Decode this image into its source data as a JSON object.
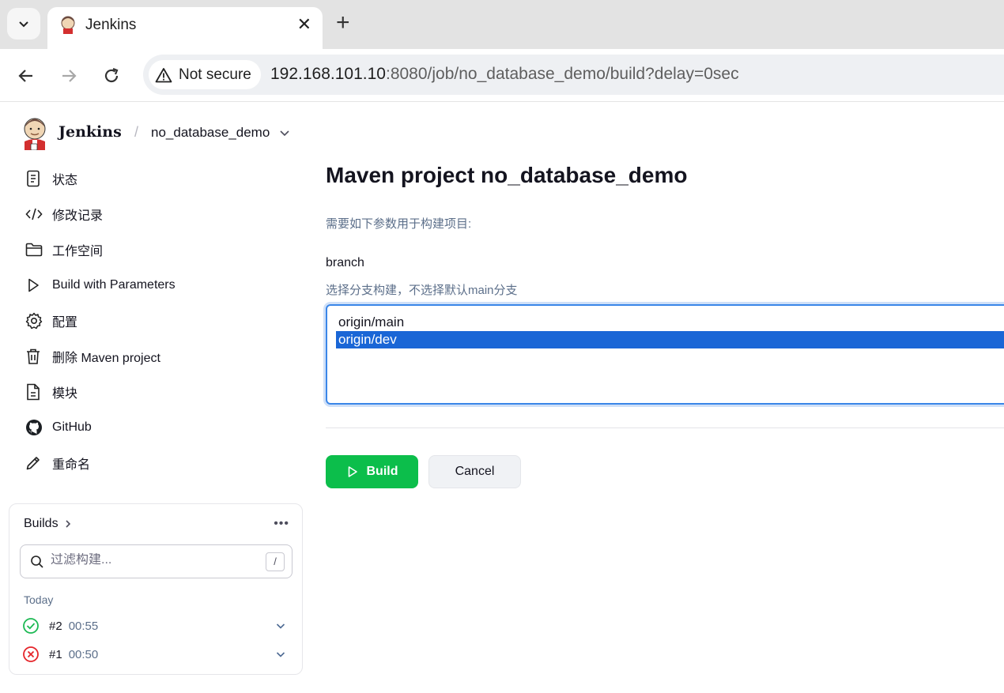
{
  "browser": {
    "tab_title": "Jenkins",
    "tab_close": "✕",
    "new_tab": "+",
    "security_label": "Not secure",
    "url_host": "192.168.101.10",
    "url_rest": ":8080/job/no_database_demo/build?delay=0sec"
  },
  "header": {
    "brand": "Jenkins",
    "separator": "/",
    "breadcrumb_job": "no_database_demo"
  },
  "sidebar": {
    "items": [
      {
        "label": "状态",
        "icon": "document-icon"
      },
      {
        "label": "修改记录",
        "icon": "code-icon"
      },
      {
        "label": "工作空间",
        "icon": "folder-icon"
      },
      {
        "label": "Build with Parameters",
        "icon": "play-icon"
      },
      {
        "label": "配置",
        "icon": "gear-icon"
      },
      {
        "label": "删除 Maven project",
        "icon": "trash-icon"
      },
      {
        "label": "模块",
        "icon": "file-icon"
      },
      {
        "label": "GitHub",
        "icon": "github-icon"
      },
      {
        "label": "重命名",
        "icon": "pencil-icon"
      }
    ]
  },
  "builds": {
    "title": "Builds",
    "more": "•••",
    "filter_placeholder": "过滤构建...",
    "filter_shortcut": "/",
    "group_label": "Today",
    "rows": [
      {
        "number": "#2",
        "time": "00:55",
        "status": "success"
      },
      {
        "number": "#1",
        "time": "00:50",
        "status": "failed"
      }
    ]
  },
  "main": {
    "title": "Maven project no_database_demo",
    "description": "需要如下参数用于构建项目:",
    "param_name": "branch",
    "param_description": "选择分支构建，不选择默认main分支",
    "options": [
      {
        "label": "origin/main",
        "selected": false
      },
      {
        "label": "origin/dev",
        "selected": true
      }
    ],
    "build_label": "Build",
    "cancel_label": "Cancel"
  },
  "colors": {
    "accent_green": "#0cbe4b",
    "selection_blue": "#1a66d6",
    "success": "#1db954",
    "failure": "#e5252a"
  }
}
